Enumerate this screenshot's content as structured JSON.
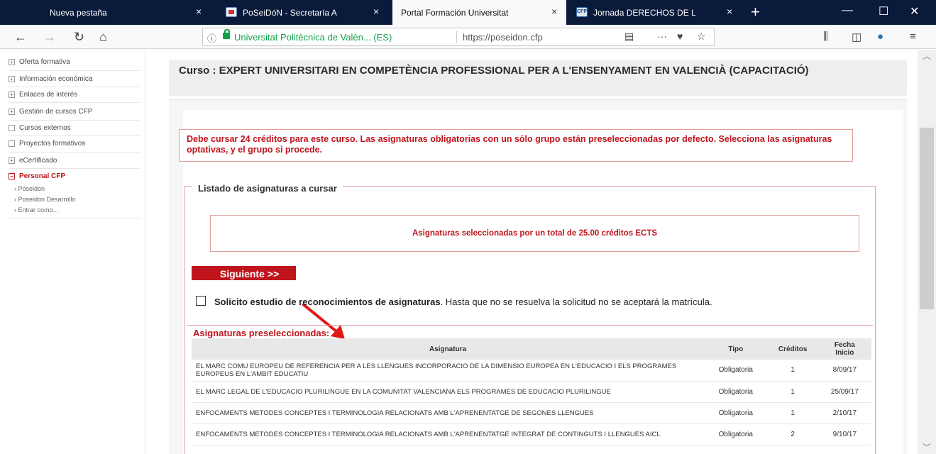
{
  "browser": {
    "tabs": [
      {
        "title": "Nueva pestaña",
        "active": false
      },
      {
        "title": "PoSeiDóN - Secretaría A",
        "active": false
      },
      {
        "title": "Portal Formación Universitat",
        "active": true
      },
      {
        "title": "Jornada DERECHOS DE L",
        "active": false
      }
    ],
    "identity": "Universitat Politècnica de Valèn... (ES)",
    "url": "https://poseidon.cfp",
    "close_glyph": "×"
  },
  "sidebar": {
    "items": [
      {
        "label": "Oferta formativa",
        "icon": "plus-box-icon"
      },
      {
        "label": "Información económica",
        "icon": "plus-box-icon"
      },
      {
        "label": "Enlaces de interés",
        "icon": "plus-box-icon"
      },
      {
        "label": "Gestión de cursos CFP",
        "icon": "plus-box-icon"
      },
      {
        "label": "Cursos externos",
        "icon": "empty-box-icon"
      },
      {
        "label": "Proyectos formativos",
        "icon": "empty-box-icon"
      },
      {
        "label": "eCertificado",
        "icon": "plus-box-icon"
      },
      {
        "label": "Personal CFP",
        "icon": "minus-box-icon"
      }
    ],
    "subitems": [
      "Poseidon",
      "Poseidon Desarrollo",
      "Entrar como..."
    ]
  },
  "course": {
    "title": "Curso : EXPERT UNIVERSITARI EN COMPETÈNCIA PROFESSIONAL PER A L'ENSENYAMENT EN VALENCIÀ (CAPACITACIÓ)"
  },
  "notice": "Debe cursar 24 créditos para este curso. Las asignaturas obligatorias con un sólo grupo están preseleccionadas por defecto. Selecciona las asignaturas optativas, y el grupo si procede.",
  "listado": {
    "legend": "Listado de asignaturas a cursar",
    "selected_summary": "Asignaturas seleccionadas por un total de 25.00 créditos ECTS",
    "next_button": "Siguiente >>",
    "request_bold": "Solicito estudio de reconocimientos de asignaturas",
    "request_rest": ". Hasta que no se resuelva la solicitud no se aceptará la matrícula.",
    "preselected_title": "Asignaturas preseleccionadas:"
  },
  "table": {
    "headers": {
      "asignatura": "Asignatura",
      "tipo": "Tipo",
      "creditos": "Créditos",
      "fecha_line1": "Fecha",
      "fecha_line2": "Inicio"
    },
    "rows": [
      {
        "asignatura": "EL MARC COMU EUROPEU DE REFERENCIA PER A LES LLENGUES INCORPORACIO DE LA DIMENSIO EUROPEA EN L'EDUCACIO I ELS PROGRAMES EUROPEUS EN L'AMBIT EDUCATIU",
        "tipo": "Obligatoria",
        "creditos": "1",
        "fecha": "8/09/17"
      },
      {
        "asignatura": "EL MARC LEGAL DE L'EDUCACIO PLURILINGUE EN LA COMUNITAT VALENCIANA ELS PROGRAMES DE EDUCACIO PLURILINGUE",
        "tipo": "Obligatoria",
        "creditos": "1",
        "fecha": "25/09/17"
      },
      {
        "asignatura": "ENFOCAMENTS METODES CONCEPTES I TERMINOLOGIA RELACIONATS AMB L'APRENENTATGE DE SEGONES LLENGUES",
        "tipo": "Obligatoria",
        "creditos": "1",
        "fecha": "2/10/17"
      },
      {
        "asignatura": "ENFOCAMENTS METODES CONCEPTES I TERMINOLOGIA RELACIONATS AMB L'APRENENTATGE INTEGRAT DE CONTINGUTS I LLENGUES AICL",
        "tipo": "Obligatoria",
        "creditos": "2",
        "fecha": "9/10/17"
      }
    ]
  },
  "colors": {
    "accent": "#c0141c",
    "tabbar": "#0a1a3a"
  }
}
